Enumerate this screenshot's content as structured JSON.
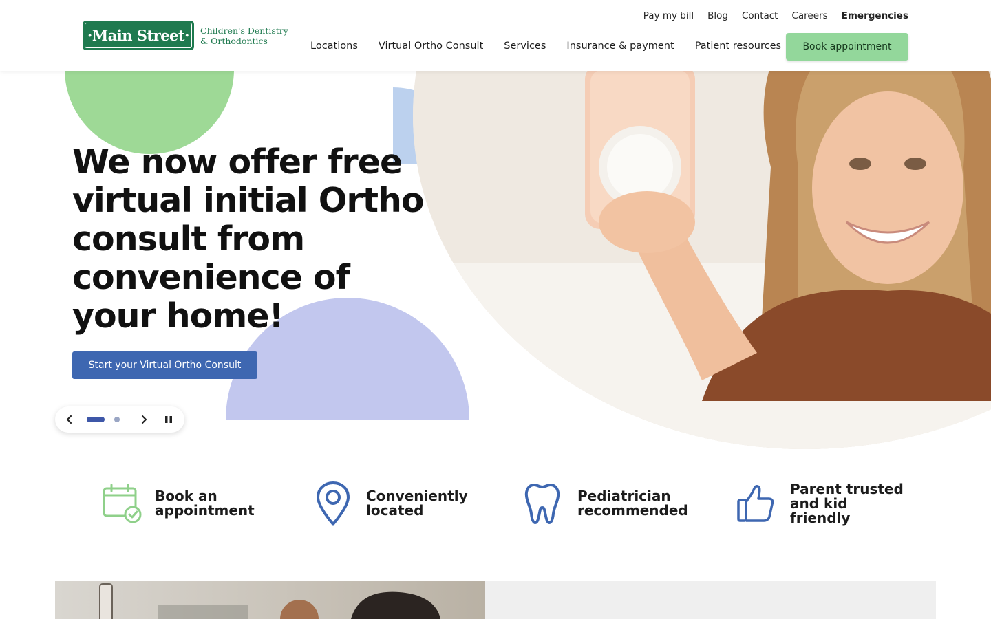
{
  "brand": {
    "logo_text": "·Main Street·",
    "tagline_line1": "Children's Dentistry",
    "tagline_line2": "& Orthodontics",
    "green": "#1f7a4f"
  },
  "utility_nav": [
    "Pay my bill",
    "Blog",
    "Contact",
    "Careers",
    "Emergencies"
  ],
  "main_nav": [
    "Locations",
    "Virtual Ortho Consult",
    "Services",
    "Insurance & payment",
    "Patient resources"
  ],
  "book_button": "Book appointment",
  "hero": {
    "title": "We now offer free virtual initial Ortho consult from convenience of your home!",
    "cta": "Start your Virtual Ortho Consult",
    "active_slide": 1,
    "slide_count": 2,
    "image_description_icon": "girl-taking-selfie-photo"
  },
  "features": [
    {
      "line1": "Book an",
      "line2": "appointment",
      "line3": "",
      "icon": "calendar-check-icon"
    },
    {
      "line1": "Conveniently",
      "line2": "located",
      "line3": "",
      "icon": "map-pin-icon"
    },
    {
      "line1": "Pediatrician",
      "line2": "recommended",
      "line3": "",
      "icon": "tooth-icon"
    },
    {
      "line1": "Parent trusted",
      "line2": "and kid",
      "line3": "friendly",
      "icon": "thumbs-up-icon"
    }
  ],
  "colors": {
    "book_button": "#93d79b",
    "cta": "#3e67b1",
    "icon_blue": "#3e67b1",
    "icon_green": "#8fd08a",
    "shape_green": "#9ed996",
    "shape_blue": "#bcd1ee",
    "shape_purple": "#c2c7ee"
  }
}
